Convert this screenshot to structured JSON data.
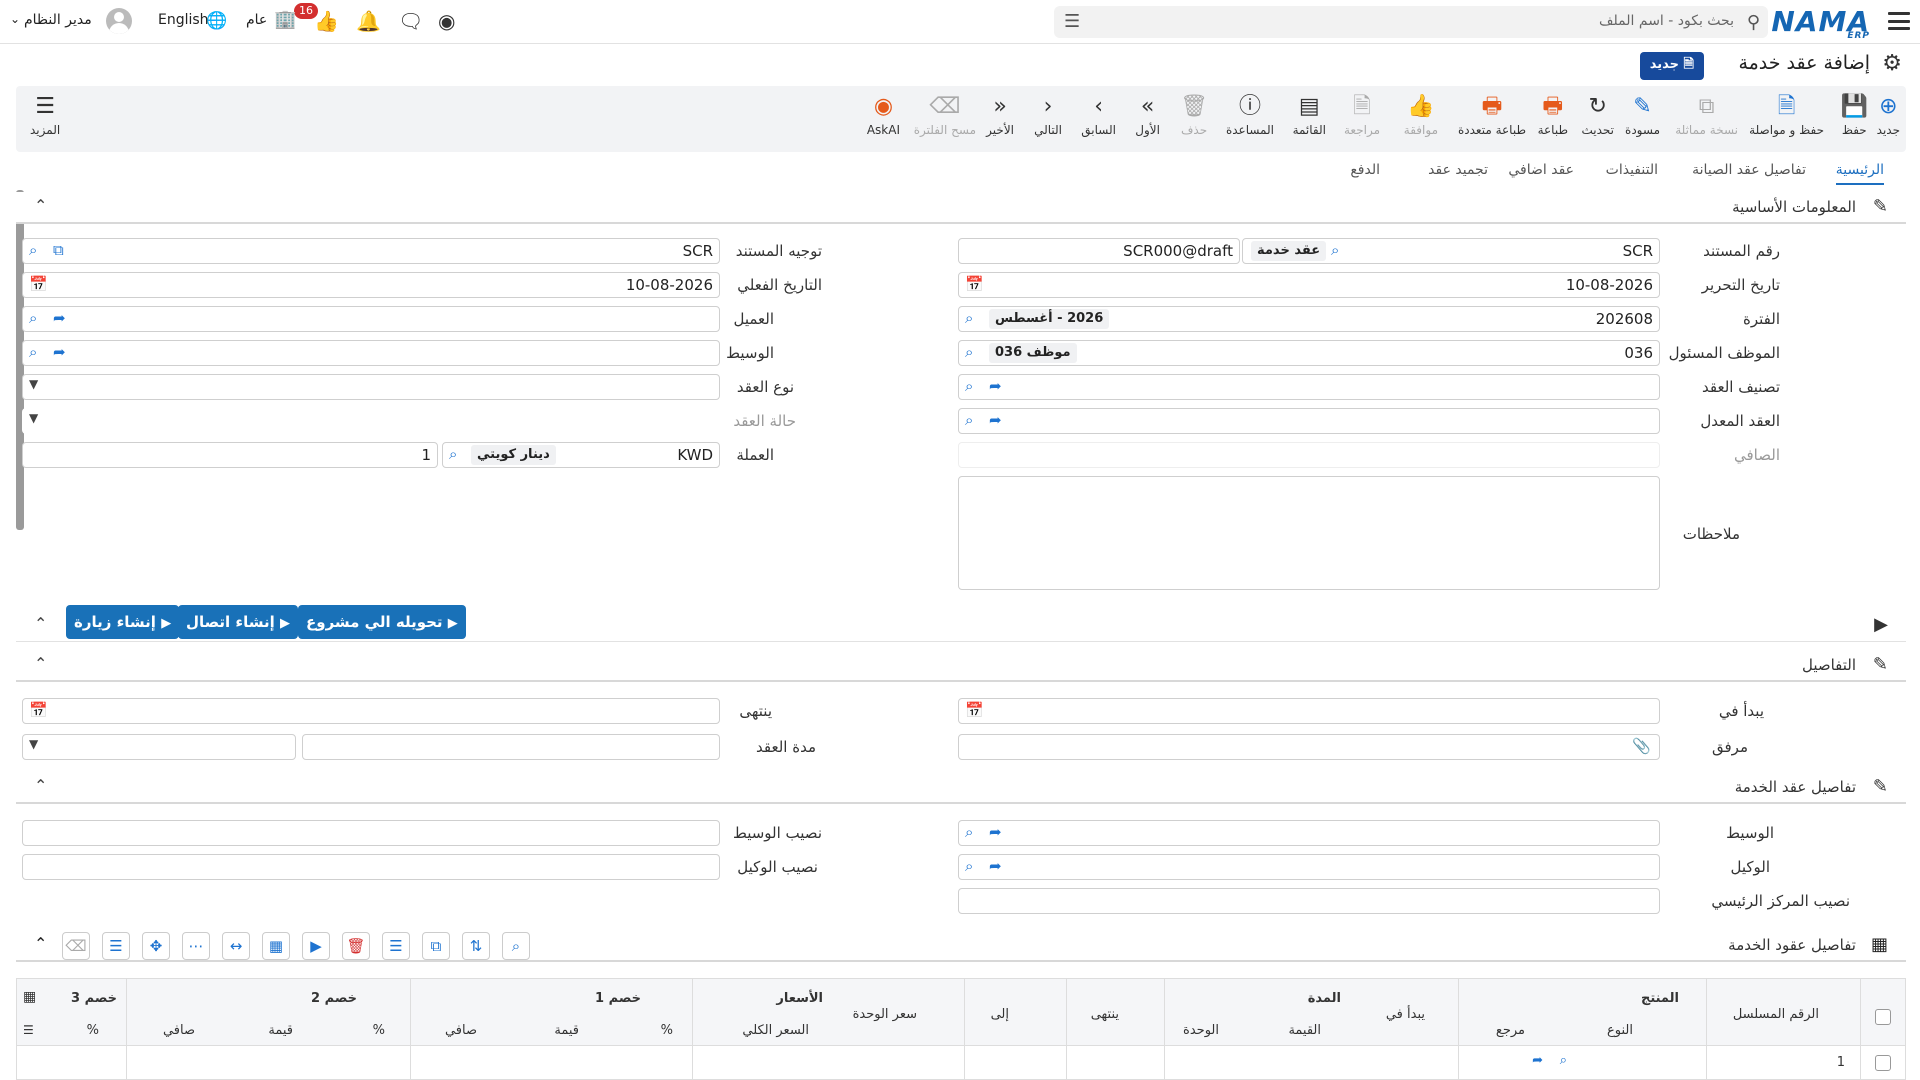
{
  "topbar": {
    "logo": "NAMA",
    "logo_sub": "ERP",
    "search_placeholder": "بحث بكود - اسم الملف",
    "notif_count": "16",
    "scope": "عام",
    "language": "English",
    "user": "مدير النظام"
  },
  "page": {
    "title": "إضافة عقد خدمة",
    "new_badge": "جديد"
  },
  "toolbar": {
    "items": [
      {
        "label": "جديد",
        "icon": "plus-circle-icon"
      },
      {
        "label": "حفظ",
        "icon": "save-icon"
      },
      {
        "label": "حفظ و مواصلة",
        "icon": "save-continue-icon"
      },
      {
        "label": "نسخة مماثلة",
        "icon": "copy-icon"
      },
      {
        "label": "مسودة",
        "icon": "draft-icon"
      },
      {
        "label": "تحديث",
        "icon": "refresh-icon"
      },
      {
        "label": "طباعة",
        "icon": "print-icon"
      },
      {
        "label": "طباعة متعددة",
        "icon": "print-multi-icon"
      },
      {
        "label": "موافقة",
        "icon": "thumbs-up-icon"
      },
      {
        "label": "مراجعة",
        "icon": "review-icon"
      },
      {
        "label": "القائمة",
        "icon": "list-icon"
      },
      {
        "label": "المساعدة",
        "icon": "help-icon"
      },
      {
        "label": "حذف",
        "icon": "trash-icon"
      },
      {
        "label": "الأول",
        "icon": "first-icon"
      },
      {
        "label": "السابق",
        "icon": "prev-icon"
      },
      {
        "label": "التالي",
        "icon": "next-icon"
      },
      {
        "label": "الأخير",
        "icon": "last-icon"
      },
      {
        "label": "مسح الفلترة",
        "icon": "clear-filter-icon"
      },
      {
        "label": "AskAI",
        "icon": "ai-icon"
      },
      {
        "label": "المزيد",
        "icon": "more-icon"
      }
    ]
  },
  "tabs": [
    "الرئيسية",
    "تفاصيل عقد الصيانة",
    "التنفيذات",
    "عقد اضافي",
    "تجميد عقد",
    "الدفع"
  ],
  "sections": {
    "basic": "المعلومات الأساسية",
    "details": "التفاصيل",
    "service_details": "تفاصيل عقد الخدمة",
    "grid": "تفاصيل عقود الخدمة"
  },
  "form": {
    "doc_no_label": "رقم المستند",
    "doc_no": "SCR",
    "doc_type": "عقد خدمة",
    "doc_draft": "SCR000@draft",
    "routing_label": "توجيه المستند",
    "routing": "SCR",
    "edit_date_label": "تاريخ التحرير",
    "edit_date": "10-08-2026",
    "actual_date_label": "التاريخ الفعلي",
    "actual_date": "10-08-2026",
    "period_label": "الفترة",
    "period": "202608",
    "period_name": "2026 - أغسطس",
    "customer_label": "العميل",
    "employee_label": "الموظف المسئول",
    "employee": "036",
    "employee_name": "موظف 036",
    "broker_label": "الوسيط",
    "contract_class_label": "تصنيف العقد",
    "contract_type_label": "نوع العقد",
    "modified_contract_label": "العقد المعدل",
    "contract_status_label": "حالة العقد",
    "net_label": "الصافي",
    "currency_label": "العملة",
    "currency": "KWD",
    "currency_name": "دينار كويتي",
    "rate": "1",
    "notes_label": "ملاحظات"
  },
  "actions": [
    "إنشاء زيارة",
    "إنشاء اتصال",
    "تحويله الي مشروع"
  ],
  "details": {
    "start_label": "يبدأ في",
    "end_label": "ينتهى",
    "attach_label": "مرفق",
    "duration_label": "مدة العقد"
  },
  "service": {
    "broker_label": "الوسيط",
    "broker_share_label": "نصيب الوسيط",
    "agent_label": "الوكيل",
    "agent_share_label": "نصيب الوكيل",
    "hq_share_label": "نصيب المركز الرئيسي"
  },
  "grid": {
    "group_headers": [
      "المنتج",
      "المدة",
      "الأسعار",
      "خصم 1",
      "خصم 2",
      "خصم 3"
    ],
    "columns": [
      "الرقم المسلسل",
      "النوع",
      "مرجع",
      "يبدأ في",
      "القيمة",
      "الوحدة",
      "ينتهى",
      "إلى",
      "سعر الوحدة",
      "السعر الكلي",
      "%",
      "قيمة",
      "صافي",
      "%",
      "قيمة",
      "صافي",
      "%"
    ],
    "row_no": "1"
  }
}
